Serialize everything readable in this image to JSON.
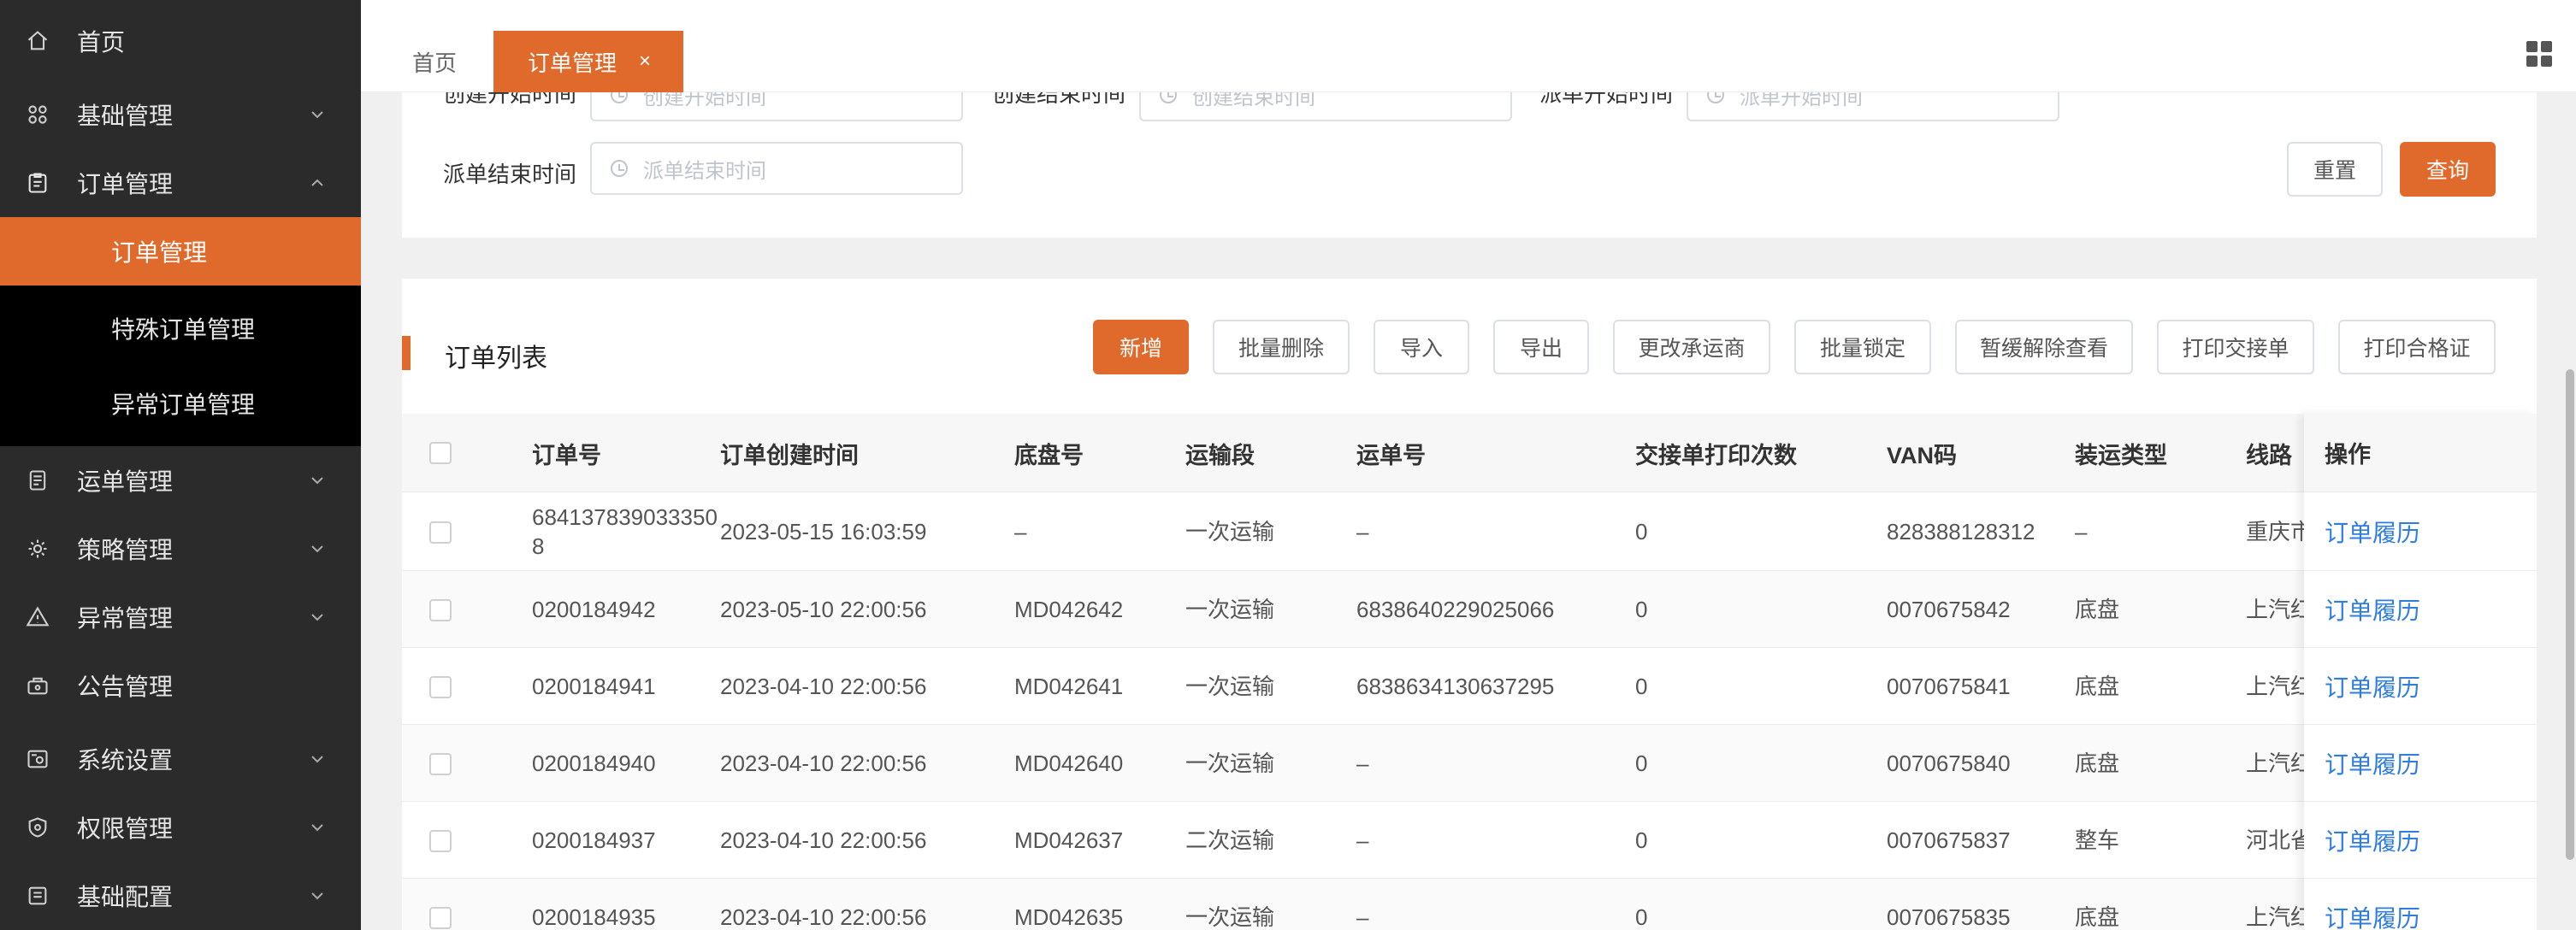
{
  "sidebar": {
    "items": [
      {
        "label": "首页",
        "icon": "home-icon"
      },
      {
        "label": "基础管理",
        "icon": "grid-icon"
      },
      {
        "label": "订单管理",
        "icon": "clipboard-icon"
      },
      {
        "label": "运单管理",
        "icon": "document-icon"
      },
      {
        "label": "策略管理",
        "icon": "gear-icon"
      },
      {
        "label": "异常管理",
        "icon": "warning-icon"
      },
      {
        "label": "公告管理",
        "icon": "megaphone-icon"
      },
      {
        "label": "系统设置",
        "icon": "settings-icon"
      },
      {
        "label": "权限管理",
        "icon": "shield-icon"
      },
      {
        "label": "基础配置",
        "icon": "list-icon"
      }
    ],
    "submenu": [
      {
        "label": "订单管理"
      },
      {
        "label": "特殊订单管理"
      },
      {
        "label": "异常订单管理"
      }
    ]
  },
  "tabs": {
    "home": "首页",
    "active": "订单管理",
    "close": "×"
  },
  "filters": {
    "created_start_label": "创建开始时间",
    "created_start_placeholder": "创建开始时间",
    "created_end_label": "创建结束时间",
    "created_end_placeholder": "创建结束时间",
    "dispatch_start_label": "派单开始时间",
    "dispatch_start_placeholder": "派单开始时间",
    "dispatch_end_label": "派单结束时间",
    "dispatch_end_placeholder": "派单结束时间",
    "reset": "重置",
    "query": "查询"
  },
  "list": {
    "title": "订单列表",
    "toolbar": [
      "新增",
      "批量删除",
      "导入",
      "导出",
      "更改承运商",
      "批量锁定",
      "暂缓解除查看",
      "打印交接单",
      "打印合格证"
    ],
    "columns": [
      "订单号",
      "订单创建时间",
      "底盘号",
      "运输段",
      "运单号",
      "交接单打印次数",
      "VAN码",
      "装运类型",
      "线路",
      "操作"
    ],
    "rows": [
      {
        "order_no": "6841378390333508",
        "created": "2023-05-15 16:03:59",
        "chassis": "–",
        "segment": "一次运输",
        "waybill": "–",
        "print_count": "0",
        "van": "828388128312",
        "ship_type": "–",
        "route": "重庆市",
        "action": "订单履历"
      },
      {
        "order_no": "0200184942",
        "created": "2023-05-10 22:00:56",
        "chassis": "MD042642",
        "segment": "一次运输",
        "waybill": "6838640229025066",
        "print_count": "0",
        "van": "0070675842",
        "ship_type": "底盘",
        "route": "上汽红",
        "action": "订单履历"
      },
      {
        "order_no": "0200184941",
        "created": "2023-04-10 22:00:56",
        "chassis": "MD042641",
        "segment": "一次运输",
        "waybill": "6838634130637295",
        "print_count": "0",
        "van": "0070675841",
        "ship_type": "底盘",
        "route": "上汽红",
        "action": "订单履历"
      },
      {
        "order_no": "0200184940",
        "created": "2023-04-10 22:00:56",
        "chassis": "MD042640",
        "segment": "一次运输",
        "waybill": "–",
        "print_count": "0",
        "van": "0070675840",
        "ship_type": "底盘",
        "route": "上汽红",
        "action": "订单履历"
      },
      {
        "order_no": "0200184937",
        "created": "2023-04-10 22:00:56",
        "chassis": "MD042637",
        "segment": "二次运输",
        "waybill": "–",
        "print_count": "0",
        "van": "0070675837",
        "ship_type": "整车",
        "route": "河北省",
        "action": "订单履历"
      },
      {
        "order_no": "0200184935",
        "created": "2023-04-10 22:00:56",
        "chassis": "MD042635",
        "segment": "一次运输",
        "waybill": "–",
        "print_count": "0",
        "van": "0070675835",
        "ship_type": "底盘",
        "route": "上汽红",
        "action": "订单履历"
      }
    ]
  },
  "colors": {
    "accent": "#e06a2b",
    "sidebar_bg": "#2b2b2b",
    "link": "#2f7de1"
  }
}
